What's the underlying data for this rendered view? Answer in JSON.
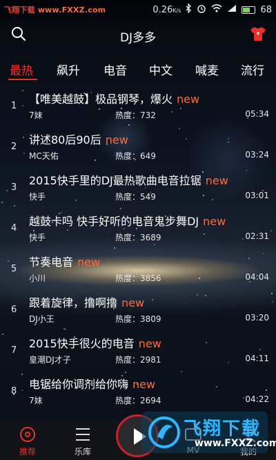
{
  "status_bar": {
    "brand": "飞翔下载",
    "brand_url": "www.FXXZ.com",
    "speed": "0.26",
    "speed_unit": "K/s",
    "battery": "68"
  },
  "header": {
    "title": "DJ多多",
    "left_icon": "search-icon",
    "right_icon": "tshirt-icon"
  },
  "tabs": [
    {
      "label": "最热",
      "active": true
    },
    {
      "label": "飙升",
      "active": false
    },
    {
      "label": "电音",
      "active": false
    },
    {
      "label": "中文",
      "active": false
    },
    {
      "label": "喊麦",
      "active": false
    },
    {
      "label": "流行",
      "active": false
    }
  ],
  "songs": [
    {
      "rank": "1",
      "title": "【唯美越鼓】极品钢琴，爆火",
      "new": "new",
      "artist": "7妹",
      "heat": "热度：732",
      "duration": "05:34"
    },
    {
      "rank": "2",
      "title": "讲述80后90后",
      "new": "new",
      "artist": "MC天佑",
      "heat": "热度：649",
      "duration": "03:24"
    },
    {
      "rank": "3",
      "title": "2015快手里的DJ最热歌曲电音拉锯",
      "new": "new",
      "artist": "快手",
      "heat": "热度：549",
      "duration": "03:01"
    },
    {
      "rank": "4",
      "title": "越鼓卡吗 快手好听的电音鬼步舞DJ",
      "new": "new",
      "artist": "快手",
      "heat": "热度：3689",
      "duration": "02:31"
    },
    {
      "rank": "5",
      "title": "节奏电音",
      "new": "new",
      "artist": "小川",
      "heat": "热度：3856",
      "duration": "04:04"
    },
    {
      "rank": "6",
      "title": "跟着旋律，撸啊撸",
      "new": "new",
      "artist": "DJ小王",
      "heat": "热度：3809",
      "duration": "03:20"
    },
    {
      "rank": "7",
      "title": "2015快手很火的电音",
      "new": "new",
      "artist": "皇潮DJ才子",
      "heat": "热度：2981",
      "duration": "04:11"
    },
    {
      "rank": "8",
      "title": "电锯给你调剂给你嗨",
      "new": "new",
      "artist": "7妹",
      "heat": "热度：2694",
      "duration": "04:22"
    }
  ],
  "bottom_nav": [
    {
      "label": "推荐",
      "icon": "disc-icon",
      "active": true
    },
    {
      "label": "乐库",
      "icon": "list-icon",
      "active": false
    },
    {
      "label": "MV",
      "icon": "video-icon",
      "active": false
    },
    {
      "label": "我的",
      "icon": "user-icon",
      "active": false
    }
  ],
  "watermark": {
    "title": "飞翔下载",
    "url": "www.FXXZ.com"
  },
  "colors": {
    "accent": "#e8312a",
    "new_tag": "#ff6a3c",
    "watermark": "#2fb8ff"
  }
}
